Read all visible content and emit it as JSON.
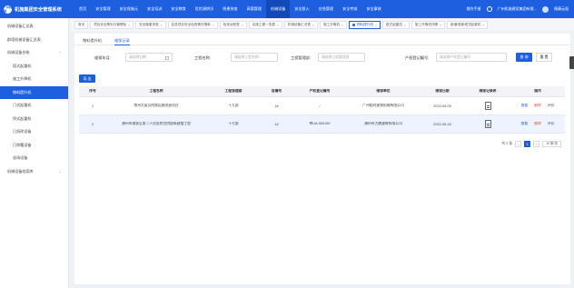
{
  "app": {
    "logo_mark": "广州机施",
    "title": "机施集团安全管理系统"
  },
  "nav": [
    {
      "label": "首页"
    },
    {
      "label": "安全管理"
    },
    {
      "label": "安全保施元"
    },
    {
      "label": "安全培训"
    },
    {
      "label": "安全教育"
    },
    {
      "label": "危险源辨识"
    },
    {
      "label": "隐患排查"
    },
    {
      "label": "高管管理"
    },
    {
      "label": "机械设备"
    },
    {
      "label": "安全投入"
    },
    {
      "label": "应急管理"
    },
    {
      "label": "安全考核"
    },
    {
      "label": "安全事故"
    }
  ],
  "top_right": {
    "manual": "操作手册",
    "company": "广州机施建设集团有限...",
    "user": "隋康云祖"
  },
  "sidebar": {
    "items": [
      {
        "label": "机械设备汇总表"
      },
      {
        "label": "群塔机械设备汇总表"
      },
      {
        "label": "机械设备台账"
      },
      {
        "label": "塔式起重机"
      },
      {
        "label": "施工升降机"
      },
      {
        "label": "物料提升机"
      },
      {
        "label": "门式起重机"
      },
      {
        "label": "桥式起重机"
      },
      {
        "label": "已拆除设备"
      },
      {
        "label": "已除籍设备"
      },
      {
        "label": "退场设备"
      },
      {
        "label": "机械设备档案库"
      }
    ]
  },
  "page_tabs": [
    {
      "label": "首页"
    },
    {
      "label": "项目安全策划与管理检"
    },
    {
      "label": "安全隐患排查"
    },
    {
      "label": "应急项目安全检查情况清单"
    },
    {
      "label": "检查台账表"
    },
    {
      "label": "实施工程一览表"
    },
    {
      "label": "机械设备汇总表"
    },
    {
      "label": "施工升降机"
    },
    {
      "label": "物料提升机"
    },
    {
      "label": "塔式起重机"
    },
    {
      "label": "施工升降机详情"
    },
    {
      "label": "新增/更新塔式起重机"
    }
  ],
  "sub_tabs": {
    "tab1": "物料提升机",
    "tab2": "维保记录"
  },
  "filters": {
    "date_label": "维保年月:",
    "date_placeholder": "请选择日期",
    "project_label": "工程名称:",
    "project_placeholder": "请选择工程名称",
    "dept_label": "工程管理部:",
    "dept_placeholder": "请选择工程管理部",
    "reg_label": "产权登记编号:",
    "reg_placeholder": "请选择产权登记编号",
    "search_btn": "查 询",
    "reset_btn": "重 置"
  },
  "export_btn": "导 出",
  "table": {
    "headers": [
      "序号",
      "工程名称",
      "工程管理部",
      "自编号",
      "产权登记编号",
      "维保单位",
      "维保日期",
      "维保记录表",
      "操作"
    ],
    "rows": [
      {
        "no": "1",
        "project": "常州大厦及附属设施改造项目",
        "dept": "十九部",
        "self_no": "1#",
        "reg_no": "/",
        "unit": "广州临时建筑机械有限公司",
        "date": "2022-05-05",
        "op_view": "查看",
        "op_del": "删除",
        "op_eval": "评价"
      },
      {
        "no": "2",
        "project": "潮州市潮安区第二人民医院住院部新建楼工程",
        "dept": "十七部",
        "self_no": "1#",
        "reg_no": "粤UA-500150",
        "unit": "潮州市大鹏建筑有限公司",
        "date": "2022-06-16",
        "op_view": "查看",
        "op_del": "删除",
        "op_eval": "评价"
      }
    ]
  },
  "pager": {
    "total": "共 2 条",
    "prev": "<",
    "page": "1",
    "next": ">",
    "size": "10 条/页"
  },
  "colors": {
    "primary": "#1e5fe0",
    "danger": "#e0463b"
  }
}
